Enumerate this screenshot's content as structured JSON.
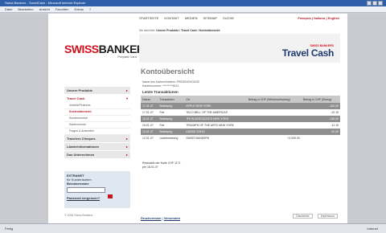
{
  "window": {
    "title": "Swiss Bankers - TravelCash - Microsoft Internet Explorer"
  },
  "menubar": [
    "Datei",
    "Bearbeiten",
    "Ansicht",
    "Favoriten",
    "Extras",
    "?"
  ],
  "topnav": [
    "Startseite",
    "Kontakt",
    "Medien",
    "Sitemap",
    "Suche"
  ],
  "lang": "Français | Italiano | English",
  "logo": {
    "swiss": "SWISS",
    "bankers": "BANKERS",
    "tagline": "Prepaid Card"
  },
  "sidebar": {
    "items": [
      {
        "label": "Unsere Produkte",
        "arrow": "▸"
      },
      {
        "label": "Travel Cash",
        "arrow": "▾"
      }
    ],
    "subitems": [
      "Vorteile/Features",
      "Kostenübersicht",
      "Kundenservice",
      "Kartenverlust",
      "Fragen & Antworten"
    ],
    "items2": [
      {
        "label": "Travelers Cheques",
        "arrow": "▸"
      },
      {
        "label": "Länderinformationen",
        "arrow": "▸"
      },
      {
        "label": "Das Unternehmen",
        "arrow": "▸"
      }
    ]
  },
  "login": {
    "title": "EXTRANET",
    "subtitle": "für Kundenkarten",
    "field_label": "Benutzername",
    "forgot": "Passwort vergessen?"
  },
  "breadcrumb": {
    "prefix": "Sie sind hier:",
    "path": "Unsere Produkte / Travel Cash / Kontoübersicht"
  },
  "banner": {
    "small": "SWISS BANKERS",
    "big": "Travel Cash"
  },
  "page_title": "Kontoübersicht",
  "meta": {
    "line1": "Name des Karteninhabers: PREDINGHOUSE",
    "line2": "Kartennummer: *********3024"
  },
  "section_title": "Letzte Transaktionen",
  "table": {
    "headers": [
      "Datum",
      "Transaktion",
      "Ort",
      "Betrag in CHF (Wiederaufladung)",
      "Betrag in CHF (Bezug)"
    ],
    "rows": [
      [
        "17.01.07",
        "Belastung",
        "APPLE NEW YORK",
        "",
        "-163.00"
      ],
      [
        "17.01.07",
        "Fee",
        "TACO BELL OF THE AMERICAS",
        "",
        "-12.15"
      ],
      [
        "16.01.07",
        "Belastung",
        "TRI W ASSOCIATES NEW YORK",
        "",
        "-148.00"
      ],
      [
        "15.01.07",
        "Fee",
        "TRIUMPH OF THE ARTS NEW YORK",
        "",
        "-11.15"
      ],
      [
        "13.01.07",
        "Belastung",
        "DANSK SOHO",
        "",
        "-20.00"
      ],
      [
        "12.01.07",
        "Ladebelastung",
        "SWISS BANKERS",
        "+2,000.00",
        ""
      ]
    ]
  },
  "balance": {
    "line1": "Restsaldo der Karte CHF 1171",
    "line2": "per 18.01.07"
  },
  "links": {
    "print": "Druckversion",
    "send": "Versenden"
  },
  "footer": {
    "left": "© 2006 Swiss Bankers",
    "right1": "Disclaimer",
    "right2": "Impressum"
  },
  "status": {
    "left": "Fertig",
    "right": "Internet"
  }
}
